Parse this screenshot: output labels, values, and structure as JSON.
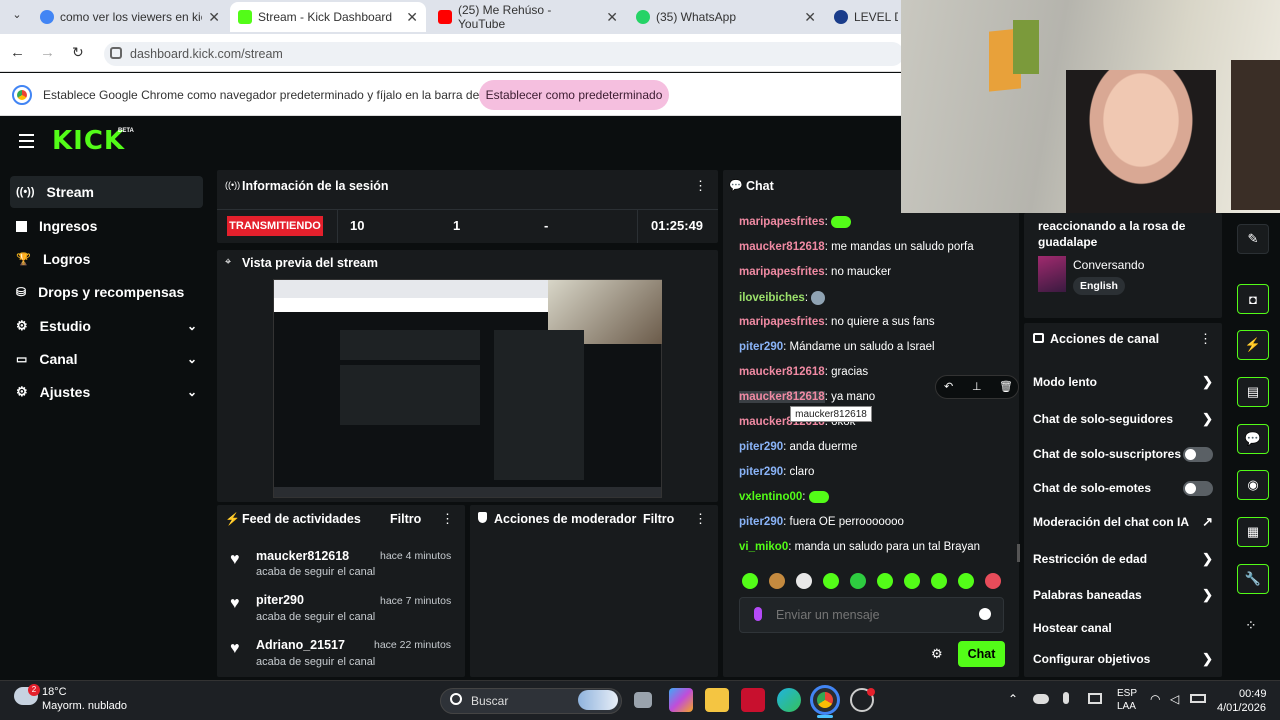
{
  "browser": {
    "tabs": [
      {
        "label": "como ver los viewers en kick - ",
        "color": "#4285f4"
      },
      {
        "label": "Stream - Kick Dashboard",
        "color": "#53fc18"
      },
      {
        "label": "(25) Me Rehúso - YouTube",
        "color": "#ff0000"
      },
      {
        "label": "(35) WhatsApp",
        "color": "#25d366"
      },
      {
        "label": "LEVEL DEV",
        "color": "#1a3c8a"
      }
    ],
    "url": "dashboard.kick.com/stream",
    "infobar_text": "Establece Google Chrome como navegador predeterminado y fíjalo en la barra de tareas",
    "infobar_button": "Establecer como predeterminado"
  },
  "kick": {
    "logo": "KICK",
    "beta": "BETA",
    "nav": [
      {
        "label": "Stream",
        "icon": "broadcast-icon"
      },
      {
        "label": "Ingresos",
        "icon": "chart-icon"
      },
      {
        "label": "Logros",
        "icon": "trophy-icon"
      },
      {
        "label": "Drops y recompensas",
        "icon": "drops-icon"
      },
      {
        "label": "Estudio",
        "icon": "gear-icon"
      },
      {
        "label": "Canal",
        "icon": "display-icon"
      },
      {
        "label": "Ajustes",
        "icon": "gear-icon"
      }
    ],
    "session": {
      "title": "Información de la sesión",
      "status": "TRANSMITIENDO",
      "viewers": "10",
      "followers": "1",
      "dash": "-",
      "time": "01:25:49"
    },
    "preview": {
      "title": "Vista previa del stream"
    },
    "activity": {
      "title": "Feed de actividades",
      "filter": "Filtro",
      "items": [
        {
          "name": "maucker812618",
          "time": "hace 4 minutos",
          "sub": "acaba de seguir el canal"
        },
        {
          "name": "piter290",
          "time": "hace 7 minutos",
          "sub": "acaba de seguir el canal"
        },
        {
          "name": "Adriano_21517",
          "time": "hace 22 minutos",
          "sub": "acaba de seguir el canal"
        }
      ]
    },
    "mod": {
      "title": "Acciones de moderador",
      "filter": "Filtro"
    },
    "chat": {
      "title": "Chat",
      "messages": [
        {
          "user": "maripapesfrites",
          "text": "",
          "color": "#f08aa3"
        },
        {
          "user": "maucker812618",
          "text": "me mandas un saludo porfa",
          "color": "#f08aa3"
        },
        {
          "user": "maripapesfrites",
          "text": "no maucker",
          "color": "#f08aa3"
        },
        {
          "user": "iloveibiches",
          "text": "",
          "color": "#9be16b"
        },
        {
          "user": "maripapesfrites",
          "text": "no quiere a sus fans",
          "color": "#f08aa3"
        },
        {
          "user": "piter290",
          "text": "Mándame un saludo a Israel",
          "color": "#8ab4f8"
        },
        {
          "user": "maucker812618",
          "text": "gracias",
          "color": "#f08aa3"
        },
        {
          "user": "maucker812618",
          "text": "ya mano",
          "color": "#f08aa3"
        },
        {
          "user": "maucker812618",
          "text": "okok",
          "color": "#f08aa3"
        },
        {
          "user": "piter290",
          "text": "anda duerme",
          "color": "#8ab4f8"
        },
        {
          "user": "piter290",
          "text": "claro",
          "color": "#8ab4f8"
        },
        {
          "user": "vxlentino00",
          "text": "",
          "color": "#53fc18"
        },
        {
          "user": "piter290",
          "text": "fuera OE perrooooooo",
          "color": "#8ab4f8"
        },
        {
          "user": "vi_miko0",
          "text": "manda un saludo para un tal Brayan",
          "color": "#53fc18"
        }
      ],
      "tooltip": "maucker812618",
      "placeholder": "Enviar un mensaje",
      "send": "Chat"
    },
    "stream_info": {
      "title": "reaccionando a la rosa de guadalape",
      "category": "Conversando",
      "language": "English"
    },
    "channel_actions": {
      "title": "Acciones de canal",
      "items": [
        {
          "label": "Modo lento",
          "control": "arrow"
        },
        {
          "label": "Chat de solo-seguidores",
          "control": "arrow"
        },
        {
          "label": "Chat de solo-suscriptores",
          "control": "toggle"
        },
        {
          "label": "Chat de solo-emotes",
          "control": "toggle"
        },
        {
          "label": "Moderación del chat con IA",
          "control": "external"
        },
        {
          "label": "Restricción de edad",
          "control": "arrow"
        },
        {
          "label": "Palabras baneadas",
          "control": "arrow"
        },
        {
          "label": "Hostear canal",
          "control": "none"
        },
        {
          "label": "Configurar objetivos",
          "control": "arrow"
        }
      ]
    }
  },
  "taskbar": {
    "temp": "18°C",
    "weather": "Mayorm. nublado",
    "badge": "2",
    "search": "Buscar",
    "lang1": "ESP",
    "lang2": "LAA",
    "clock": "00:49",
    "date": "4/01/2026"
  }
}
